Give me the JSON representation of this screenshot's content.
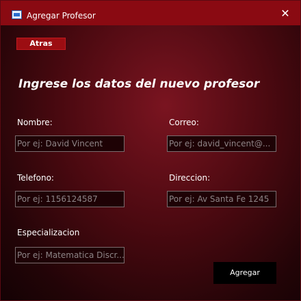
{
  "window": {
    "title": "Agregar Profesor",
    "close_glyph": "✕",
    "app_icon": "app-icon",
    "accent_color": "#8a0a12"
  },
  "back_button": {
    "label": "Atras"
  },
  "heading": "Ingrese los datos del nuevo profesor",
  "form": {
    "nombre": {
      "label": "Nombre:",
      "value": "",
      "placeholder": "Por ej: David Vincent"
    },
    "correo": {
      "label": "Correo:",
      "value": "",
      "placeholder": "Por ej: david_vincent@..."
    },
    "telefono": {
      "label": "Telefono:",
      "value": "",
      "placeholder": "Por ej: 1156124587"
    },
    "direccion": {
      "label": "Direccion:",
      "value": "",
      "placeholder": "Por ej: Av Santa Fe 1245"
    },
    "especializacion": {
      "label": "Especializacion",
      "value": "",
      "placeholder": "Por ej: Matematica Discr..."
    }
  },
  "submit_button": {
    "label": "Agregar"
  }
}
